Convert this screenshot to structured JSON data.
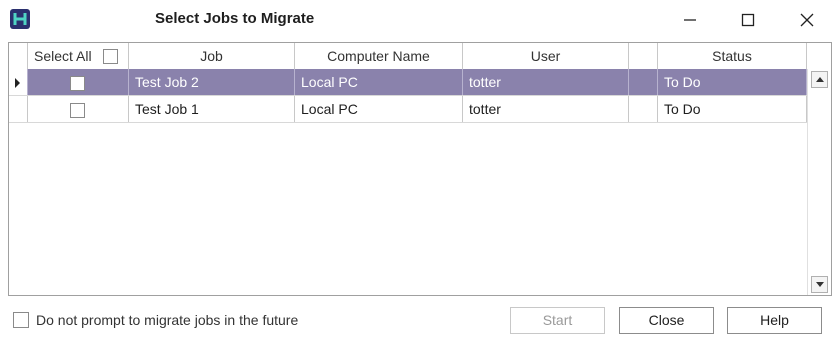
{
  "window": {
    "title": "Select Jobs to Migrate"
  },
  "grid": {
    "columns": {
      "select_all": "Select All",
      "job": "Job",
      "computer_name": "Computer Name",
      "user": "User",
      "blank": "",
      "status": "Status"
    },
    "rows": [
      {
        "job": "Test Job 2",
        "computer_name": "Local PC",
        "user": "totter",
        "status": "To Do",
        "selected": true
      },
      {
        "job": "Test Job 1",
        "computer_name": "Local PC",
        "user": "totter",
        "status": "To Do",
        "selected": false
      }
    ]
  },
  "footer": {
    "do_not_prompt_label": "Do not prompt to migrate jobs in the future",
    "start_label": "Start",
    "close_label": "Close",
    "help_label": "Help"
  },
  "colors": {
    "selected_row": "#8a82ac",
    "app_icon": "#2a2f6e",
    "app_icon_glyph": "#4fd3c4"
  }
}
